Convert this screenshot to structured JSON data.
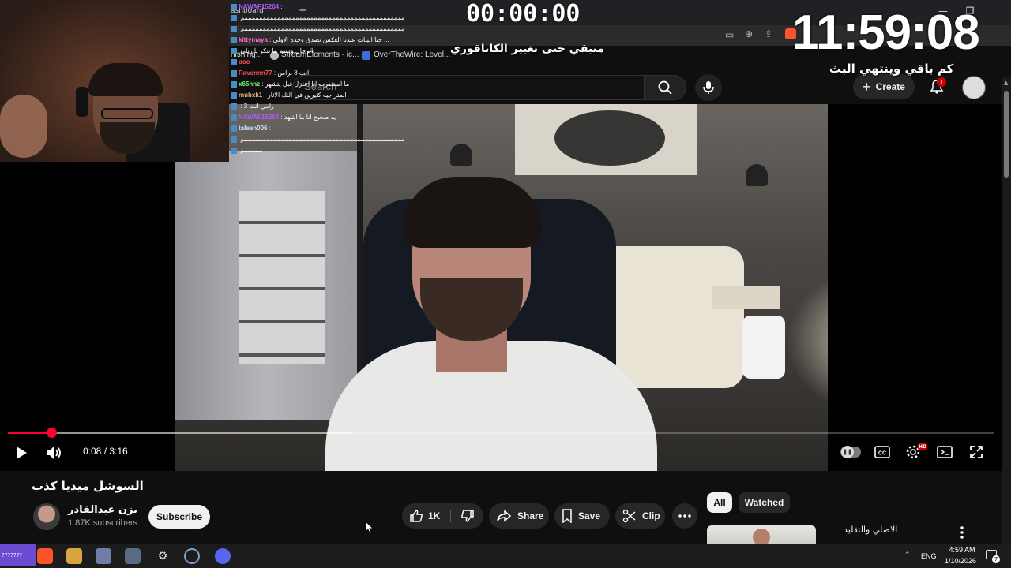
{
  "browser": {
    "tab_label_partial": "ashboard",
    "bookmarks": [
      "nishing...",
      "StreamElements - ic...",
      "OverTheWire: Level..."
    ]
  },
  "youtube_header": {
    "search_placeholder": "Search",
    "create_label": "Create",
    "notification_count": "1"
  },
  "player": {
    "time_display": "0:08 / 3:16",
    "progress_fraction": 0.044,
    "buffered_fraction": 0.35,
    "hd_label": "HD"
  },
  "video": {
    "title": "السوشل ميديا كذب",
    "channel_name": "يزن عبدالقادر",
    "subscriber_count": "1.87K subscribers",
    "subscribe_label": "Subscribe",
    "like_count": "1K",
    "share_label": "Share",
    "save_label": "Save",
    "clip_label": "Clip"
  },
  "sidebar": {
    "chips": [
      "All",
      "Watched"
    ],
    "recommendation_title": "الاصلي والتقليد"
  },
  "stream_overlay": {
    "timer": "00:00:00",
    "category_note": "متبقي حتى تغيير الكاتاقوري",
    "clock": "11:59:08",
    "clock_caption": "كم باقي وينتهي البث"
  },
  "chat": [
    {
      "user": "NAWAF15264",
      "msg": ":",
      "color": "#b15cff"
    },
    {
      "user": "",
      "msg": "ممممممممممممممممممممممممممممممممممممممممممممم",
      "color": "#ffffff"
    },
    {
      "user": "",
      "msg": "ممممممممممممممممممممممممممممممممممممممممممممم",
      "color": "#ffffff"
    },
    {
      "user": "kittymaya",
      "msg": ": حتا البنات عندنا العكس تصدق وحده الاولى ...",
      "color": "#ff6bd0"
    },
    {
      "user": "",
      "msg": "الرجال وسيم ما تنكر يا ريلي",
      "color": "#ffffff"
    },
    {
      "user": "ooo",
      "msg": "",
      "color": "#ff4d4d"
    },
    {
      "user": "Ravennn77",
      "msg": ": انت 8 براس",
      "color": "#ff4d4d"
    },
    {
      "user": "x65hhz",
      "msg": ": ما استطرب انا اعتزل قبل يتشهر",
      "color": "#6bff6b"
    },
    {
      "user": "mubxk1",
      "msg": ": المتراجيه كثيرين في التك الاثار",
      "color": "#e0b070"
    },
    {
      "user": "",
      "msg": ": رامي انت 3",
      "color": "#ff4d4d"
    },
    {
      "user": "NAWAF15264",
      "msg": ": يه صحيح انا ما اشهد",
      "color": "#b15cff"
    },
    {
      "user": "taleen006",
      "msg": ":",
      "color": "#cfe7ff"
    },
    {
      "user": "",
      "msg": "ممممممممممممممممممممممممممممممممممممممممممممم",
      "color": "#ffffff"
    },
    {
      "user": "",
      "msg": "مممممم",
      "color": "#ffffff"
    }
  ],
  "taskbar": {
    "start_label": "???????",
    "lang": "ENG",
    "time": "4:59 AM",
    "date": "1/10/2026",
    "notification_count": "7"
  },
  "colors": {
    "accent_red": "#ff0033",
    "background": "#0f0f0f",
    "pill_bg": "#272727"
  }
}
